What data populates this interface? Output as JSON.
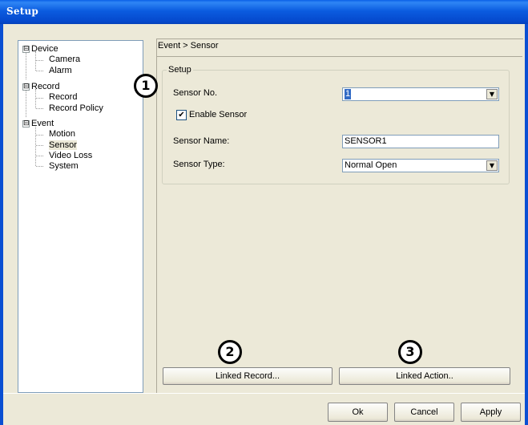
{
  "window": {
    "title": "Setup"
  },
  "tree": {
    "items": [
      {
        "label": "Device",
        "expander": "⊟"
      },
      {
        "label": "Camera"
      },
      {
        "label": "Alarm"
      },
      {
        "label": "Record",
        "expander": "⊟"
      },
      {
        "label": "Record"
      },
      {
        "label": "Record Policy"
      },
      {
        "label": "Event",
        "expander": "⊟"
      },
      {
        "label": "Motion"
      },
      {
        "label": "Sensor",
        "selected": true
      },
      {
        "label": "Video Loss"
      },
      {
        "label": "System"
      }
    ]
  },
  "breadcrumb": "Event > Sensor",
  "setup_group": {
    "label": "Setup",
    "sensor_no_label": "Sensor No.",
    "sensor_no_value": "1",
    "enable_sensor_label": "Enable Sensor",
    "enable_sensor_checked": "✔",
    "sensor_name_label": "Sensor Name:",
    "sensor_name_value": "SENSOR1",
    "sensor_type_label": "Sensor Type:",
    "sensor_type_value": "Normal Open"
  },
  "buttons": {
    "linked_record": "Linked Record...",
    "linked_action": "Linked Action..",
    "ok": "Ok",
    "cancel": "Cancel",
    "apply": "Apply"
  },
  "callouts": [
    "1",
    "2",
    "3"
  ],
  "icons": {
    "dropdown_arrow": "▼",
    "checkmark": "✔"
  }
}
